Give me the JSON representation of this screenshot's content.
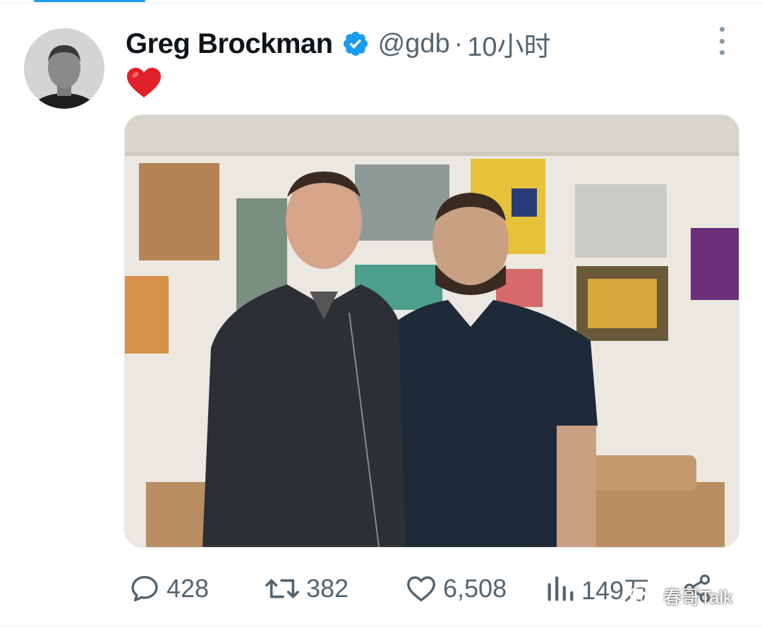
{
  "tweet": {
    "author_name": "Greg Brockman",
    "handle": "@gdb",
    "separator": "·",
    "time": "10小时",
    "text_emoji": "red-heart-emoji",
    "verified": true
  },
  "actions": {
    "replies": "428",
    "retweets": "382",
    "likes": "6,508",
    "views": "149万"
  },
  "watermark": {
    "label": "春哥Talk"
  },
  "icons": [
    "verified-badge-icon",
    "more-icon",
    "reply-icon",
    "retweet-icon",
    "like-icon",
    "views-icon",
    "share-icon",
    "wechat-icon"
  ],
  "colors": {
    "accent": "#1d9bf0",
    "secondary_text": "#536471",
    "heart": "#e0202a"
  }
}
